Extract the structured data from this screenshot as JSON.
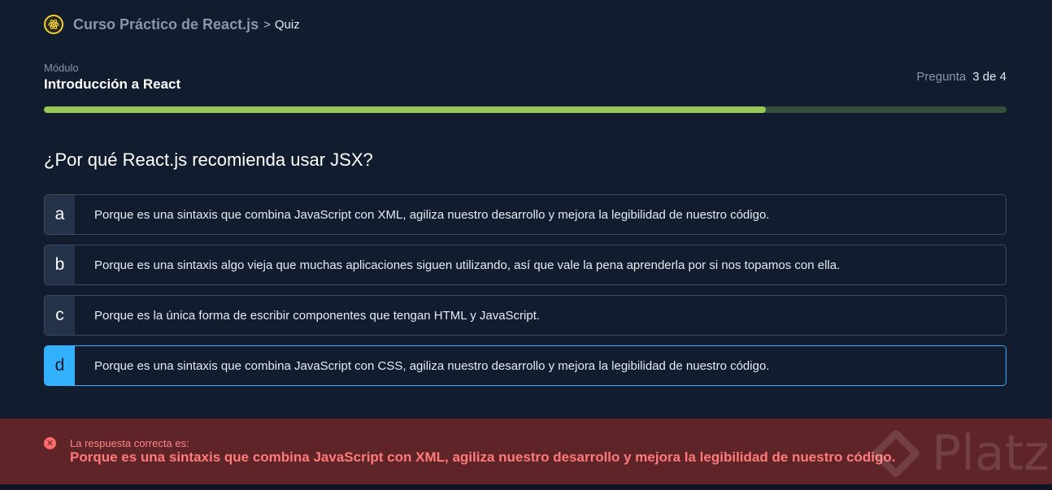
{
  "header": {
    "course_title": "Curso Práctico de React.js",
    "separator": ">",
    "current": "Quiz"
  },
  "module": {
    "label": "Módulo",
    "name": "Introducción a React"
  },
  "counter": {
    "label": "Pregunta",
    "value": "3 de 4"
  },
  "progress": {
    "fraction": 0.75
  },
  "question": "¿Por qué React.js recomienda usar JSX?",
  "options": [
    {
      "letter": "a",
      "text": "Porque es una sintaxis que combina JavaScript con XML, agiliza nuestro desarrollo y mejora la legibilidad de nuestro código."
    },
    {
      "letter": "b",
      "text": "Porque es una sintaxis algo vieja que muchas aplicaciones siguen utilizando, así que vale la pena aprenderla por si nos topamos con ella."
    },
    {
      "letter": "c",
      "text": "Porque es la única forma de escribir componentes que tengan HTML y JavaScript."
    },
    {
      "letter": "d",
      "text": "Porque es una sintaxis que combina JavaScript con CSS, agiliza nuestro desarrollo y mejora la legibilidad de nuestro código."
    }
  ],
  "selected_option": "d",
  "feedback": {
    "icon": "error-circle-icon",
    "label": "La respuesta correcta es:",
    "answer": "Porque es una sintaxis que combina JavaScript con XML, agiliza nuestro desarrollo y mejora la legibilidad de nuestro código."
  },
  "watermark": {
    "text": "Platzi"
  },
  "colors": {
    "background": "#121c2f",
    "progress_fill": "#97c754",
    "progress_track": "#34503a",
    "selected": "#33b1ff",
    "feedback_bg": "#5e2428",
    "feedback_text": "#ff7a7a"
  }
}
